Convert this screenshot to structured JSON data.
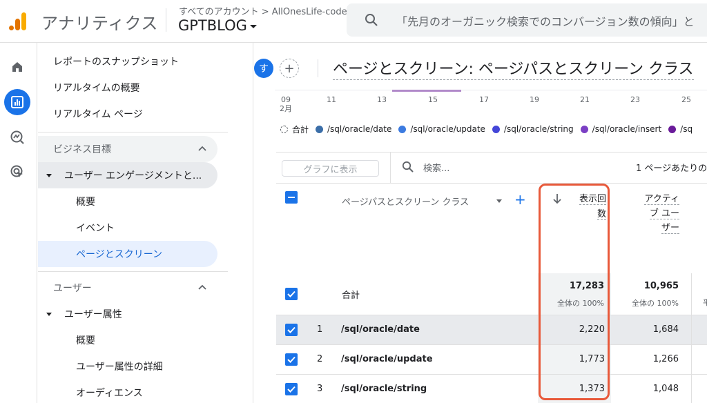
{
  "header": {
    "app_title": "アナリティクス",
    "breadcrumb_all": "すべてのアカウント",
    "breadcrumb_sep": ">",
    "breadcrumb_account": "AllOnesLife-code",
    "property": "GPTBLOG",
    "search_placeholder": "「先月のオーガニック検索でのコンバージョン数の傾向」と"
  },
  "rail": {
    "items": [
      "home-icon",
      "reports-icon",
      "explore-icon",
      "advertising-icon"
    ],
    "active": "reports-icon"
  },
  "sidenav": {
    "top_items": [
      "レポートのスナップショット",
      "リアルタイムの概要",
      "リアルタイム ページ"
    ],
    "section_business": "ビジネス目標",
    "group_engagement": "ユーザー エンゲージメントと...",
    "engagement_items": [
      "概要",
      "イベント",
      "ページとスクリーン"
    ],
    "selected": "ページとスクリーン",
    "section_user": "ユーザー",
    "group_attributes": "ユーザー属性",
    "attribute_items": [
      "概要",
      "ユーザー属性の詳細",
      "オーディエンス"
    ]
  },
  "main": {
    "avatar_letter": "す",
    "add_comparison": "+",
    "title": "ページとスクリーン: ページパスとスクリーン クラス",
    "x_ticks": [
      {
        "day": "09",
        "month": "2月"
      },
      {
        "day": "11",
        "month": ""
      },
      {
        "day": "13",
        "month": ""
      },
      {
        "day": "15",
        "month": ""
      },
      {
        "day": "17",
        "month": ""
      },
      {
        "day": "19",
        "month": ""
      },
      {
        "day": "21",
        "month": ""
      },
      {
        "day": "23",
        "month": ""
      },
      {
        "day": "25",
        "month": ""
      }
    ],
    "legend": [
      {
        "label": "合計",
        "color": "",
        "total": true
      },
      {
        "label": "/sql/oracle/date",
        "color": "#3b6ea8"
      },
      {
        "label": "/sql/oracle/update",
        "color": "#3c7be0"
      },
      {
        "label": "/sql/oracle/string",
        "color": "#4446d8"
      },
      {
        "label": "/sql/oracle/insert",
        "color": "#7b3fc4"
      },
      {
        "label": "/sq",
        "color": "#6a1b9a"
      }
    ],
    "chart_button": "グラフに表示",
    "table_search": "検索...",
    "rows_per_page": "1 ページあたりの"
  },
  "table": {
    "dimension_header": "ページパスとスクリーン クラス",
    "add_dimension": "+",
    "views_header_line1": "表示回",
    "views_header_line2": "数",
    "active_header_line1": "アクティ",
    "active_header_line2": "ブ ユー",
    "active_header_line3": "ザー",
    "total_label": "合計",
    "total_views": "17,283",
    "total_views_sub": "全体の 100%",
    "total_active": "10,965",
    "total_active_sub": "全体の 100%",
    "cut_off": "平",
    "rows": [
      {
        "index": "1",
        "path": "/sql/oracle/date",
        "views": "2,220",
        "active": "1,684"
      },
      {
        "index": "2",
        "path": "/sql/oracle/update",
        "views": "1,773",
        "active": "1,266"
      },
      {
        "index": "3",
        "path": "/sql/oracle/string",
        "views": "1,373",
        "active": "1,048"
      }
    ]
  },
  "colors": {
    "accent": "#1a73e8",
    "highlight_box": "#e8593a",
    "selected_nav_bg": "#e8f0fe"
  }
}
